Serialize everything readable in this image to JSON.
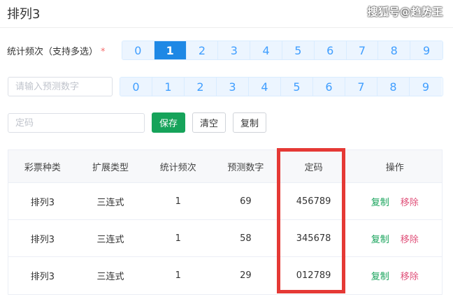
{
  "header": {
    "title": "排列3",
    "watermark": "搜狐号@趋势王"
  },
  "stats_row": {
    "label": "统计频次（支持多选）",
    "required_mark": "*",
    "options": [
      "0",
      "1",
      "2",
      "3",
      "4",
      "5",
      "6",
      "7",
      "8",
      "9"
    ],
    "selected": "1"
  },
  "predict_row": {
    "input_placeholder": "请输入预测数字",
    "input_value": "",
    "options": [
      "0",
      "1",
      "2",
      "3",
      "4",
      "5",
      "6",
      "7",
      "8",
      "9"
    ]
  },
  "code_row": {
    "input_placeholder": "定码",
    "input_value": "",
    "save_label": "保存",
    "clear_label": "清空",
    "copy_label": "复制"
  },
  "table": {
    "headers": [
      "彩票种类",
      "扩展类型",
      "统计频次",
      "预测数字",
      "定码",
      "操作"
    ],
    "rows": [
      {
        "lottery": "排列3",
        "type": "三连式",
        "freq": "1",
        "predict": "69",
        "code": "456789",
        "copy": "复制",
        "remove": "移除"
      },
      {
        "lottery": "排列3",
        "type": "三连式",
        "freq": "1",
        "predict": "58",
        "code": "345678",
        "copy": "复制",
        "remove": "移除"
      },
      {
        "lottery": "排列3",
        "type": "三连式",
        "freq": "1",
        "predict": "29",
        "code": "012789",
        "copy": "复制",
        "remove": "移除"
      }
    ]
  },
  "colors": {
    "active_number": "#1e88e5",
    "save_button": "#16a35a",
    "highlight_box": "#e53935",
    "remove_link": "#e0517a"
  }
}
